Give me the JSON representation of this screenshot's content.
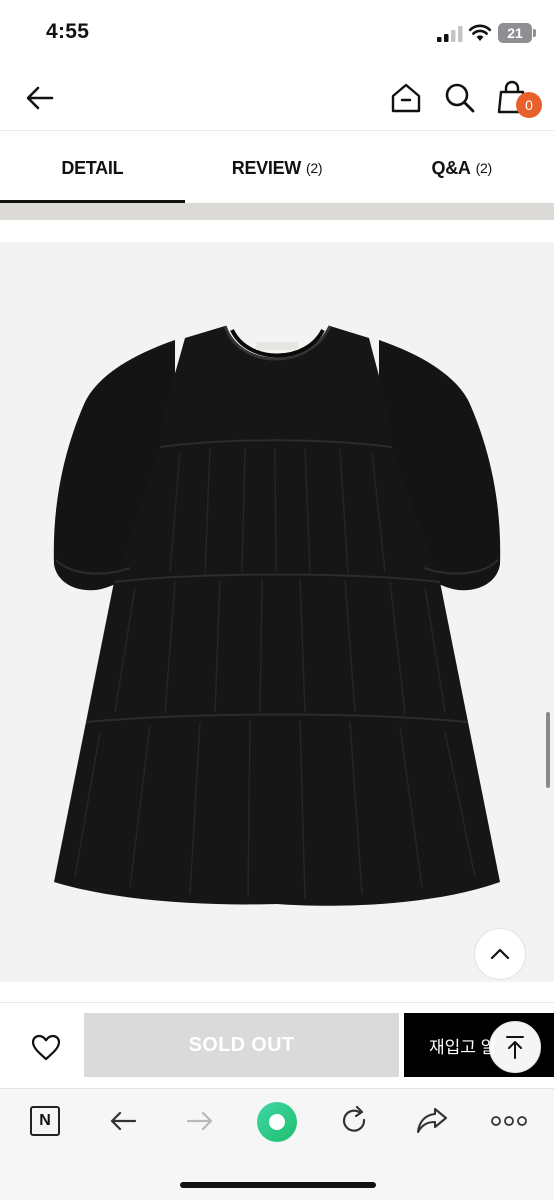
{
  "status_bar": {
    "time": "4:55",
    "battery": "21"
  },
  "header": {
    "cart_count": "0"
  },
  "tabs": [
    {
      "label": "DETAIL",
      "count": ""
    },
    {
      "label": "REVIEW",
      "count": "(2)"
    },
    {
      "label": "Q&A",
      "count": "(2)"
    }
  ],
  "active_tab": "DETAIL",
  "product": {
    "image": "black-tiered-dress",
    "neck_label": ""
  },
  "purchase": {
    "sold_out_label": "SOLD OUT",
    "restock_label": "재입고 알"
  },
  "browser": {
    "n_label": "N"
  },
  "colors": {
    "accent": "#e8612a",
    "sold_out": "#dadada",
    "restock": "#000000"
  },
  "icons": [
    "back-arrow-icon",
    "home-icon",
    "search-icon",
    "cart-icon",
    "heart-icon",
    "chevron-up-icon",
    "arrow-up-to-top-icon",
    "forward-arrow-icon",
    "reload-icon",
    "share-icon",
    "more-icon"
  ]
}
